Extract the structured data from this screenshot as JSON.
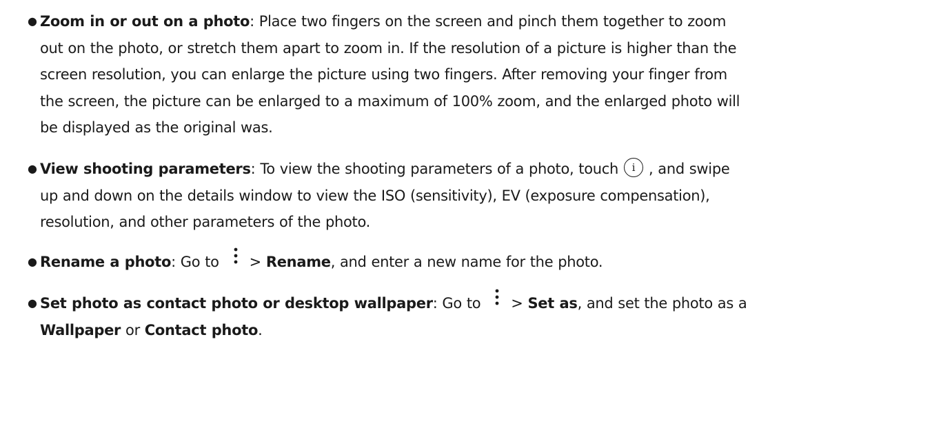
{
  "items": [
    {
      "bold": "Zoom in or out on a photo",
      "lines": [
        ": Place two fingers on the screen and pinch them together to zoom",
        "out on the photo, or stretch them apart to zoom in. If the resolution of a picture is higher than the",
        "screen resolution, you can enlarge the picture using two fingers. After removing your finger from",
        "the screen, the picture can be enlarged to a maximum of 100% zoom, and the enlarged photo will",
        "be displayed as the original was."
      ]
    },
    {
      "bold": "View shooting parameters",
      "text_before_icon": ": To view the shooting parameters of a photo, touch",
      "text_after_icon": ", and swipe",
      "icon": "info-icon",
      "lines": [
        "up and down on the details window to view the ISO (sensitivity), EV (exposure compensation),",
        "resolution, and other parameters of the photo."
      ]
    },
    {
      "bold": "Rename a photo",
      "text_before_icon": ": Go to",
      "icon": "more-options-icon",
      "menu_prefix": ">",
      "menu_bold": "Rename",
      "text_after": ", and enter a new name for the photo."
    },
    {
      "bold": "Set photo as contact photo or desktop wallpaper",
      "text_before_icon": ": Go to",
      "icon": "more-options-icon",
      "menu_prefix": ">",
      "menu_bold": "Set as",
      "text_after": ", and set the photo as a",
      "line2_bold_1": "Wallpaper",
      "line2_text": "or",
      "line2_bold_2": "Contact photo",
      "line2_end": "."
    }
  ],
  "icons": {
    "info_glyph": "i"
  }
}
